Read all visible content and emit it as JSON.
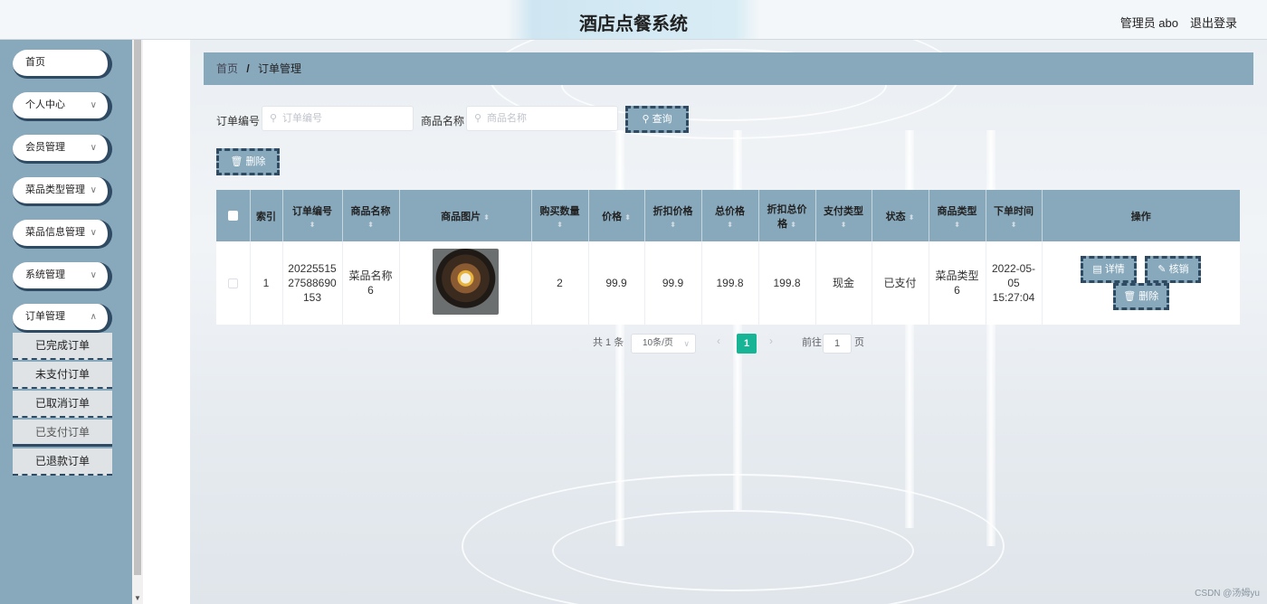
{
  "header": {
    "title": "酒店点餐系统",
    "admin": "管理员 abo",
    "logout": "退出登录"
  },
  "sidebar": {
    "items": [
      {
        "label": "首页",
        "has_chevron": false
      },
      {
        "label": "个人中心",
        "has_chevron": true
      },
      {
        "label": "会员管理",
        "has_chevron": true
      },
      {
        "label": "菜品类型管理",
        "has_chevron": true
      },
      {
        "label": "菜品信息管理",
        "has_chevron": true
      },
      {
        "label": "系统管理",
        "has_chevron": true
      },
      {
        "label": "订单管理",
        "has_chevron": true
      }
    ],
    "sub_items": [
      "已完成订单",
      "未支付订单",
      "已取消订单",
      "已支付订单",
      "已退款订单"
    ],
    "active_sub": "已支付订单"
  },
  "breadcrumb": {
    "home": "首页",
    "separator": "/",
    "current": "订单管理"
  },
  "search": {
    "order_no_label": "订单编号",
    "order_no_placeholder": "订单编号",
    "product_name_label": "商品名称",
    "product_name_placeholder": "商品名称",
    "query_button": "查询",
    "delete_button": "删除"
  },
  "table": {
    "columns": [
      "索引",
      "订单编号",
      "商品名称",
      "商品图片",
      "购买数量",
      "价格",
      "折扣价格",
      "总价格",
      "折扣总价格",
      "支付类型",
      "状态",
      "商品类型",
      "下单时间",
      "操作"
    ],
    "rows": [
      {
        "index": "1",
        "order_no": "2022551527588690153",
        "product_name": "菜品名称6",
        "quantity": "2",
        "price": "99.9",
        "discount_price": "99.9",
        "total_price": "199.8",
        "discount_total": "199.8",
        "pay_type": "现金",
        "status": "已支付",
        "category": "菜品类型6",
        "order_time": "2022-05-05 15:27:04"
      }
    ],
    "actions": {
      "detail": "详情",
      "cancel": "核销",
      "delete": "删除"
    }
  },
  "pagination": {
    "total": "共 1 条",
    "page_size": "10条/页",
    "current_page": "1",
    "goto_label": "前往",
    "goto_value": "1",
    "page_unit": "页"
  },
  "watermark": "CSDN @汤姆yu",
  "colors": {
    "accent": "#88a9bc",
    "dark_border": "#2f4a63",
    "page_active": "#17b495"
  }
}
